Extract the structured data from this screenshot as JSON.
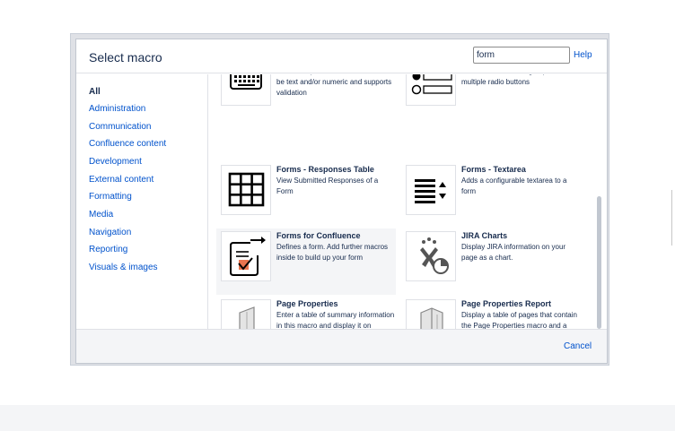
{
  "dialog": {
    "title": "Select macro",
    "search": {
      "value": "form",
      "placeholder": ""
    },
    "help_label": "Help",
    "cancel_label": "Cancel"
  },
  "sidebar": {
    "items": [
      {
        "label": "All",
        "active": true
      },
      {
        "label": "Administration"
      },
      {
        "label": "Communication"
      },
      {
        "label": "Confluence content"
      },
      {
        "label": "Development"
      },
      {
        "label": "External content"
      },
      {
        "label": "Formatting"
      },
      {
        "label": "Media"
      },
      {
        "label": "Navigation"
      },
      {
        "label": "Reporting"
      },
      {
        "label": "Visuals & images"
      }
    ]
  },
  "macros": [
    {
      "name": "",
      "desc": "Adds an input field to the form. Can be text and/or numeric and supports validation",
      "icon": "keyboard-icon"
    },
    {
      "name": "",
      "desc": "Adds a Radio button group with multiple radio buttons",
      "icon": "radio-group-icon"
    },
    {
      "name": "Forms - Responses Table",
      "desc": "View Submitted Responses of a Form",
      "icon": "table-grid-icon"
    },
    {
      "name": "Forms - Textarea",
      "desc": "Adds a configurable textarea to a form",
      "icon": "textarea-icon"
    },
    {
      "name": "Forms for Confluence",
      "desc": "Defines a form. Add further macros inside to build up your form",
      "icon": "form-checklist-icon",
      "selected": true
    },
    {
      "name": "JIRA Charts",
      "desc": "Display JIRA information on your page as a chart.",
      "icon": "jira-chart-icon"
    },
    {
      "name": "Page Properties",
      "desc": "Enter a table of summary information in this macro and display it on another page using a Page Properties Report macro.",
      "icon": "page-properties-icon"
    },
    {
      "name": "Page Properties Report",
      "desc": "Display a table of pages that contain the Page Properties macro and a specific label. The table includes a link to each page",
      "icon": "page-properties-report-icon"
    }
  ]
}
